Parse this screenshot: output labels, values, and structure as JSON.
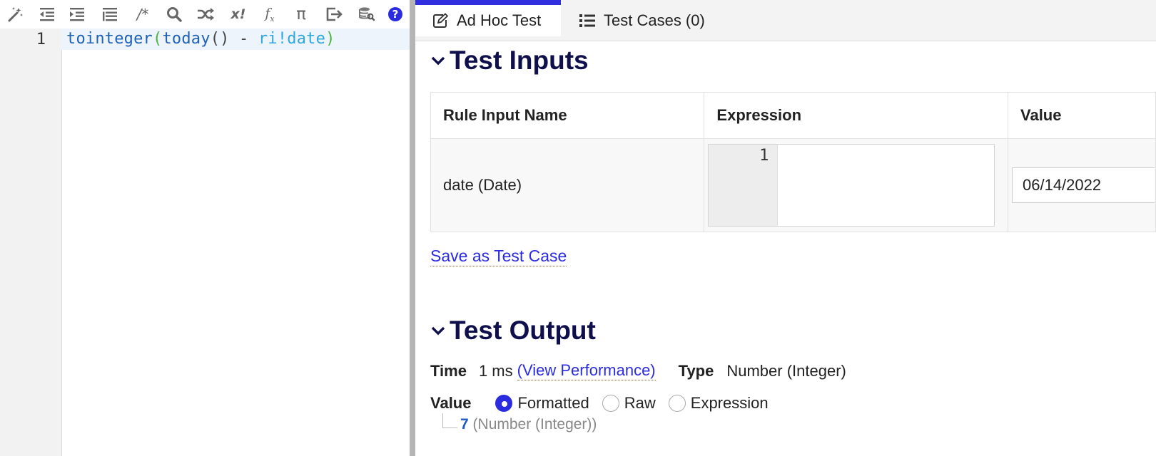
{
  "editor": {
    "toolbar": {
      "icons": [
        "magic-wand-icon",
        "outdent-icon",
        "indent-icon",
        "list-icon",
        "comment-icon",
        "search-icon",
        "shuffle-icon",
        "exclamation-variable-icon",
        "function-icon",
        "pi-icon",
        "export-icon",
        "database-search-icon",
        "help-icon"
      ],
      "comment_label": "/*",
      "var_label": "x!",
      "pi_label": "π",
      "help_label": "?"
    },
    "line_number": "1",
    "code": {
      "fn1": "tointeger",
      "open1": "(",
      "fn2": "today",
      "call": "()",
      "op": " - ",
      "ri": "ri!date",
      "close1": ")"
    }
  },
  "tabs": [
    {
      "label": "Ad Hoc Test",
      "icon": "edit-icon",
      "active": true
    },
    {
      "label": "Test Cases (0)",
      "icon": "list-icon",
      "active": false
    }
  ],
  "test_inputs": {
    "title": "Test Inputs",
    "columns": [
      "Rule Input Name",
      "Expression",
      "Value"
    ],
    "rows": [
      {
        "name": "date (Date)",
        "expression_line": "1",
        "value": "06/14/2022"
      }
    ],
    "save_link": "Save as Test Case"
  },
  "test_output": {
    "title": "Test Output",
    "time_label": "Time",
    "time_value": "1 ms",
    "perf_link": "(View Performance)",
    "type_label": "Type",
    "type_value": "Number (Integer)",
    "value_label": "Value",
    "value_modes": [
      "Formatted",
      "Raw",
      "Expression"
    ],
    "selected_mode": "Formatted",
    "result_value": "7",
    "result_type": "(Number (Integer))"
  },
  "colors": {
    "accent": "#2f2fe0",
    "heading": "#0f0f4b",
    "code_function": "#1f62b8",
    "code_paren": "#4bb543",
    "code_rule_input": "#2ea8de"
  }
}
